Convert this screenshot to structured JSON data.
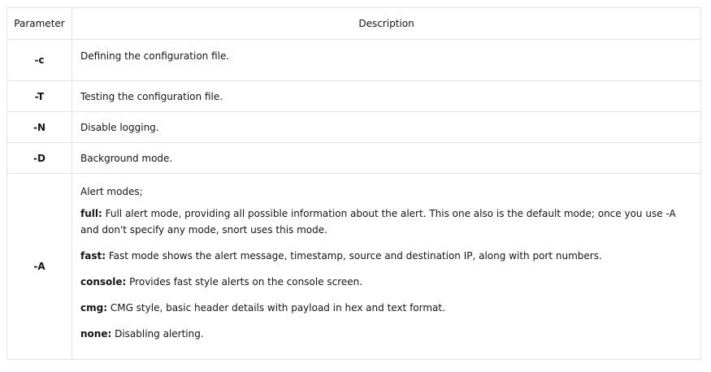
{
  "table": {
    "headers": {
      "parameter": "Parameter",
      "description": "Description"
    },
    "rows": [
      {
        "param": "-c",
        "desc": "Defining the configuration file."
      },
      {
        "param": "-T",
        "desc": "Testing the configuration file."
      },
      {
        "param": "-N",
        "desc": "Disable logging."
      },
      {
        "param": "-D",
        "desc": "Background mode."
      }
    ],
    "alert": {
      "param": "-A",
      "intro": "Alert modes;",
      "modes": [
        {
          "key": "full:",
          "text": " Full alert mode, providing all possible information about the alert. This one also is the default mode; once you use -A and don't specify any mode, snort uses this mode."
        },
        {
          "key": "fast:",
          "text": "  Fast mode shows the alert message, timestamp, source and destination IP, along with port numbers."
        },
        {
          "key": "console:",
          "text": " Provides fast style alerts on the console screen."
        },
        {
          "key": "cmg:",
          "text": " CMG style, basic header details with payload in hex and text format."
        },
        {
          "key": "none:",
          "text": " Disabling alerting."
        }
      ]
    }
  }
}
